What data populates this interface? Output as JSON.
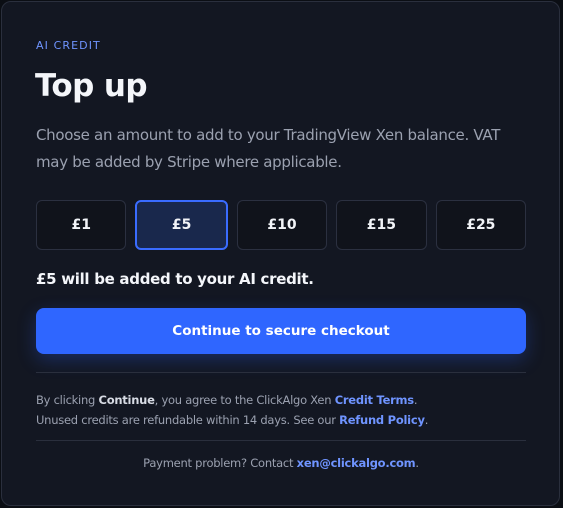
{
  "eyebrow": "AI CREDIT",
  "title": "Top up",
  "description": "Choose an amount to add to your TradingView Xen balance. VAT may be added by Stripe where applicable.",
  "amounts": [
    {
      "label": "£1",
      "selected": false
    },
    {
      "label": "£5",
      "selected": true
    },
    {
      "label": "£10",
      "selected": false
    },
    {
      "label": "£15",
      "selected": false
    },
    {
      "label": "£25",
      "selected": false
    }
  ],
  "summary": "£5 will be added to your AI credit.",
  "cta_label": "Continue to secure checkout",
  "terms": {
    "line1_prefix": "By clicking ",
    "line1_bold": "Continue",
    "line1_middle": ", you agree to the ClickAlgo Xen ",
    "line1_link": "Credit Terms",
    "line1_suffix": ".",
    "line2_prefix": "Unused credits are refundable within 14 days. See our ",
    "line2_link": "Refund Policy",
    "line2_suffix": "."
  },
  "footer": {
    "prefix": "Payment problem? Contact ",
    "email": "xen@clickalgo.com",
    "suffix": "."
  },
  "colors": {
    "accent": "#2f66ff",
    "link": "#6f94ff",
    "background": "#131722"
  }
}
